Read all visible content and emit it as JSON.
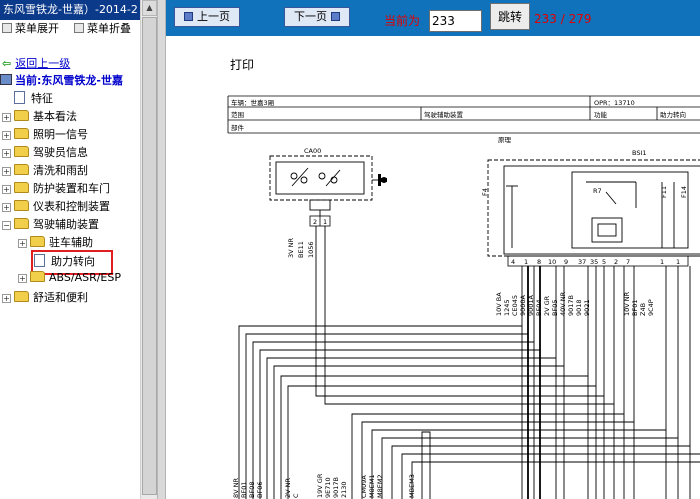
{
  "window": {
    "title": "东风雪铁龙-世嘉）-2014-2"
  },
  "nav": {
    "expand_all": "菜单展开",
    "collapse_all": "菜单折叠",
    "back": "返回上一级",
    "current": "当前:东风雪铁龙-世嘉",
    "tree": [
      {
        "label": "特征",
        "type": "doc"
      },
      {
        "label": "基本看法",
        "type": "folder"
      },
      {
        "label": "照明一信号",
        "type": "folder"
      },
      {
        "label": "驾驶员信息",
        "type": "folder"
      },
      {
        "label": "清洗和雨刮",
        "type": "folder"
      },
      {
        "label": "防护装置和车门",
        "type": "folder"
      },
      {
        "label": "仪表和控制装置",
        "type": "folder"
      },
      {
        "label": "驾驶辅助装置",
        "type": "folder"
      },
      {
        "label": "驻车辅助",
        "type": "folder"
      },
      {
        "label": "助力转向",
        "type": "doc",
        "selected": true
      },
      {
        "label": "ABS/ASR/ESP",
        "type": "folder"
      },
      {
        "label": "舒适和便利",
        "type": "folder"
      }
    ]
  },
  "toolbar": {
    "prev": "上一页",
    "next": "下一页",
    "current_label": "当前为",
    "page_value": "233",
    "jump": "跳转",
    "page_count": "233 / 279"
  },
  "document": {
    "print_label": "打印",
    "header": {
      "vehicle": "车辆：世嘉3厢",
      "opr": "OPR：13710",
      "range": "范围",
      "range_value": "驾驶辅助装置",
      "function": "功能",
      "function_value": "助力转向",
      "part": "部件",
      "schematic": "原理"
    },
    "components": {
      "left": "CA00",
      "right": "BSI1",
      "relay": "R7",
      "fuse1": "F4",
      "fuse2": "F11",
      "fuse3": "F14"
    },
    "left_wires": [
      "3V NR",
      "BE11",
      "1056"
    ],
    "left_pins": [
      "2",
      "1"
    ],
    "bsi_pins": [
      "4",
      "1",
      "8",
      "10",
      "9",
      "37",
      "35",
      "5",
      "2",
      "7",
      "1",
      "1"
    ],
    "bsi_wires": [
      "10V BA",
      "1245",
      "CE045",
      "9000A",
      "9001A",
      "BF04",
      "2V GR",
      "BF05",
      "40V NR",
      "9017B",
      "9018",
      "9021",
      "10V NR",
      "BF01",
      "Z4B",
      "9C4P"
    ],
    "bottom_wires": [
      "8V NR",
      "BF01",
      "BF08",
      "BF06",
      "2V NR",
      "C",
      "19V GR",
      "9E710",
      "9017B",
      "2130",
      "CM09A",
      "M8EM1",
      "M8EM2",
      "MBEM3"
    ]
  }
}
